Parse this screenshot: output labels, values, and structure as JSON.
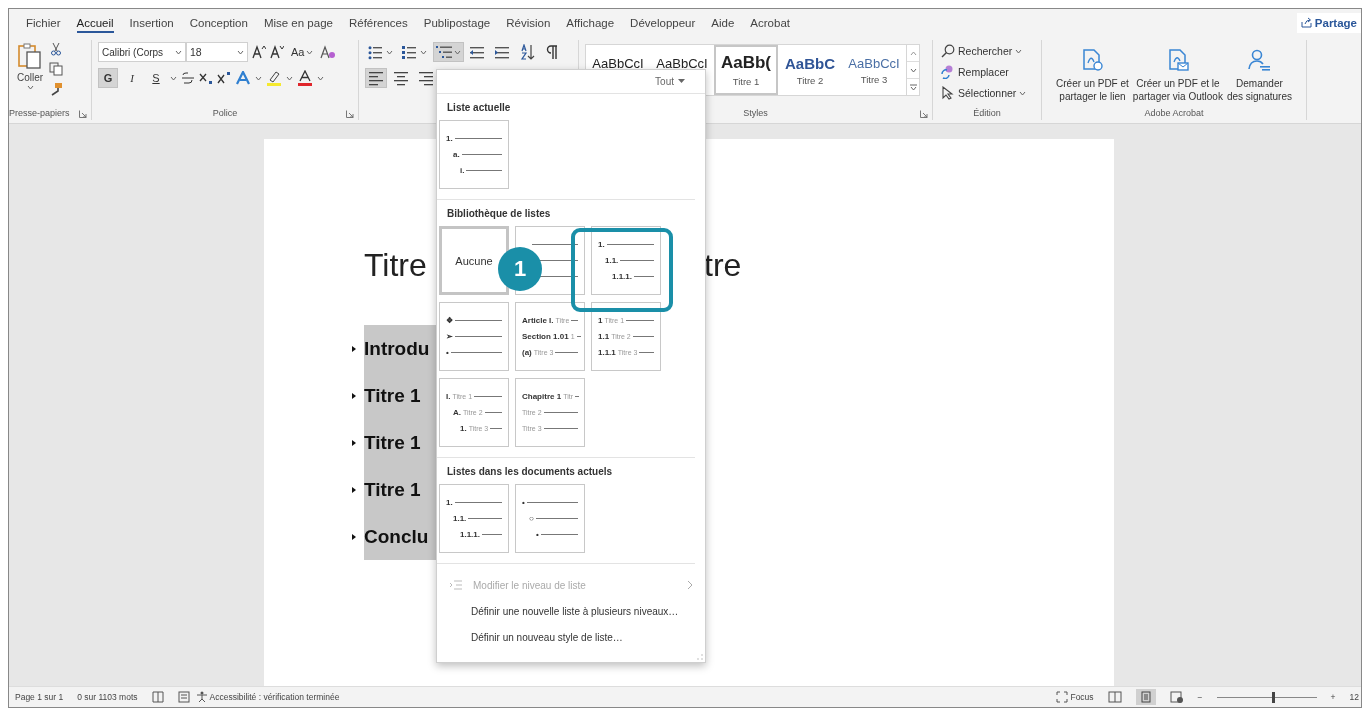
{
  "tabs": [
    {
      "label": "Fichier",
      "selected": false
    },
    {
      "label": "Accueil",
      "selected": true
    },
    {
      "label": "Insertion",
      "selected": false
    },
    {
      "label": "Conception",
      "selected": false
    },
    {
      "label": "Mise en page",
      "selected": false
    },
    {
      "label": "Références",
      "selected": false
    },
    {
      "label": "Publipostage",
      "selected": false
    },
    {
      "label": "Révision",
      "selected": false
    },
    {
      "label": "Affichage",
      "selected": false
    },
    {
      "label": "Développeur",
      "selected": false
    },
    {
      "label": "Aide",
      "selected": false
    },
    {
      "label": "Acrobat",
      "selected": false
    }
  ],
  "share_button": "Partage",
  "clipboard": {
    "paste": "Coller",
    "label": "Presse-papiers"
  },
  "font": {
    "name": "Calibri (Corps",
    "size": "18",
    "case_button": "Aa",
    "label": "Police",
    "format_buttons": [
      {
        "label": "G",
        "pressed": true
      },
      {
        "label": "I",
        "pressed": false
      },
      {
        "label": "S",
        "pressed": false
      }
    ]
  },
  "paragraph": {
    "buttons": [
      {
        "kind": "bullets",
        "pressed": false
      },
      {
        "kind": "numbering",
        "pressed": false
      },
      {
        "kind": "multilevel",
        "pressed": true
      },
      {
        "kind": "outdent",
        "pressed": false
      },
      {
        "kind": "indent",
        "pressed": false
      },
      {
        "kind": "sort",
        "pressed": false
      },
      {
        "kind": "pilcrow",
        "pressed": false
      }
    ],
    "align": [
      {
        "kind": "left",
        "pressed": true
      },
      {
        "kind": "center",
        "pressed": false
      },
      {
        "kind": "right",
        "pressed": false
      }
    ]
  },
  "styles": {
    "label": "Styles",
    "items": [
      {
        "preview": "AaBbCcI",
        "kind": "normal",
        "selected": false
      },
      {
        "preview": "AaBbCcI",
        "kind": "normal",
        "selected": false
      },
      {
        "preview": "AaBb(",
        "name": "Titre 1",
        "kind": "heading1",
        "selected": true
      },
      {
        "preview": "AaBbC",
        "name": "Titre 2",
        "kind": "heading2",
        "selected": false
      },
      {
        "preview": "AaBbCcI",
        "name": "Titre 3",
        "kind": "heading3",
        "selected": false
      }
    ]
  },
  "editing": {
    "label": "Édition",
    "items": [
      {
        "kind": "search",
        "label": "Rechercher",
        "has_menu": true
      },
      {
        "kind": "replace",
        "label": "Remplacer",
        "has_menu": false
      },
      {
        "kind": "select",
        "label": "Sélectionner",
        "has_menu": true
      }
    ]
  },
  "acrobat": {
    "label": "Adobe Acrobat",
    "buttons": [
      {
        "kind": "pdf-link",
        "label": "Créer un PDF et\npartager le lien"
      },
      {
        "kind": "pdf-mail",
        "label": "Créer un PDF et le\npartager via Outlook"
      },
      {
        "kind": "signature",
        "label": "Demander\ndes signatures"
      }
    ]
  },
  "document": {
    "title_start": "Titre",
    "title_end": "tre",
    "bullets": [
      "Introdu",
      "Titre 1",
      "Titre 1",
      "Titre 1",
      "Conclu"
    ]
  },
  "list_menu": {
    "filter": "Tout",
    "sections": [
      {
        "title": "Liste actuelle",
        "thumbnails": [
          {
            "kind": "lines",
            "indented": true,
            "selected": false,
            "lines": [
              {
                "prefix": "1."
              },
              {
                "prefix": "a."
              },
              {
                "prefix": "i."
              }
            ]
          }
        ]
      },
      {
        "title": "Bibliothèque de listes",
        "thumbnails": [
          {
            "kind": "none",
            "label": "Aucune",
            "selected": true
          },
          {
            "kind": "rules",
            "selected": false
          },
          {
            "kind": "lines",
            "indented": true,
            "selected": false,
            "lines": [
              {
                "prefix": "1."
              },
              {
                "prefix": "1.1."
              },
              {
                "prefix": "1.1.1."
              }
            ]
          },
          {
            "kind": "lines",
            "indented": false,
            "selected": false,
            "lines": [
              {
                "prefix": "❖"
              },
              {
                "prefix": "➢"
              },
              {
                "prefix": "•"
              }
            ]
          },
          {
            "kind": "lines",
            "indented": false,
            "selected": false,
            "lines": [
              {
                "prefix": "Article I.",
                "label": "Titre"
              },
              {
                "prefix": "Section 1.01",
                "label": "1"
              },
              {
                "prefix": "(a)",
                "label": "Titre 3"
              }
            ]
          },
          {
            "kind": "lines",
            "indented": false,
            "selected": false,
            "lines": [
              {
                "prefix": "1",
                "label": "Titre 1"
              },
              {
                "prefix": "1.1",
                "label": "Titre 2"
              },
              {
                "prefix": "1.1.1",
                "label": "Titre 3"
              }
            ]
          },
          {
            "kind": "lines",
            "indented": true,
            "selected": false,
            "lines": [
              {
                "prefix": "I.",
                "label": "Titre 1"
              },
              {
                "prefix": "A.",
                "label": "Titre 2"
              },
              {
                "prefix": "1.",
                "label": "Titre 3"
              }
            ]
          },
          {
            "kind": "lines",
            "indented": false,
            "selected": false,
            "lines": [
              {
                "prefix": "Chapitre 1",
                "label": "Titr"
              },
              {
                "label": "Titre 2"
              },
              {
                "label": "Titre 3"
              }
            ]
          }
        ]
      },
      {
        "title": "Listes dans les documents actuels",
        "thumbnails": [
          {
            "kind": "lines",
            "indented": true,
            "selected": false,
            "lines": [
              {
                "prefix": "1."
              },
              {
                "prefix": "1.1."
              },
              {
                "prefix": "1.1.1."
              }
            ]
          },
          {
            "kind": "lines",
            "indented": true,
            "selected": false,
            "lines": [
              {
                "prefix": "•"
              },
              {
                "prefix": "○"
              },
              {
                "prefix": "•"
              }
            ]
          }
        ]
      }
    ],
    "commands": [
      {
        "label": "Modifier le niveau de liste",
        "disabled": true,
        "submenu": true
      },
      {
        "label": "Définir une nouvelle liste à plusieurs niveaux…",
        "disabled": false,
        "submenu": false
      },
      {
        "label": "Définir un nouveau style de liste…",
        "disabled": false,
        "submenu": false
      }
    ]
  },
  "callout": {
    "number": "1"
  },
  "status_bar": {
    "page": "Page 1 sur 1",
    "words": "0 sur 1103 mots",
    "accessibility": "Accessibilité : vérification terminée",
    "focus": "Focus",
    "zoom": {
      "out": "−",
      "in": "+",
      "level": 0.55,
      "value": "12"
    }
  }
}
